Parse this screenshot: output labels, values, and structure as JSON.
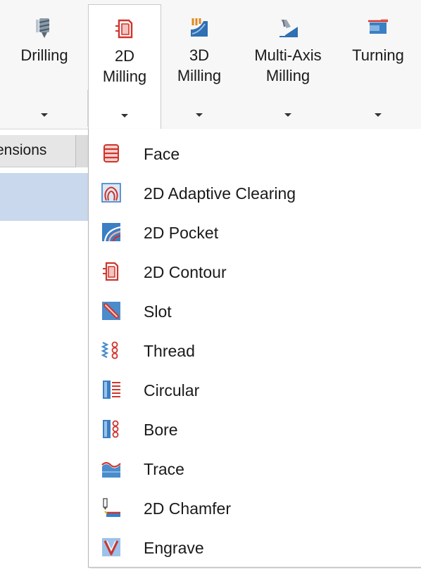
{
  "ribbon": {
    "buttons": [
      {
        "label": "Drilling",
        "icon": "drill-icon"
      },
      {
        "label": "2D\nMilling",
        "icon": "2d-milling-icon"
      },
      {
        "label": "3D\nMilling",
        "icon": "3d-milling-icon"
      },
      {
        "label": "Multi-Axis\nMilling",
        "icon": "multi-axis-milling-icon"
      },
      {
        "label": "Turning",
        "icon": "turning-icon"
      }
    ],
    "active": "2D Milling"
  },
  "panel": {
    "tab_label": "ensions"
  },
  "menu": {
    "items": [
      {
        "label": "Face",
        "icon": "face-icon"
      },
      {
        "label": "2D Adaptive Clearing",
        "icon": "adaptive-clearing-icon"
      },
      {
        "label": "2D Pocket",
        "icon": "pocket-icon"
      },
      {
        "label": "2D Contour",
        "icon": "contour-icon"
      },
      {
        "label": "Slot",
        "icon": "slot-icon"
      },
      {
        "label": "Thread",
        "icon": "thread-icon"
      },
      {
        "label": "Circular",
        "icon": "circular-icon"
      },
      {
        "label": "Bore",
        "icon": "bore-icon"
      },
      {
        "label": "Trace",
        "icon": "trace-icon"
      },
      {
        "label": "2D Chamfer",
        "icon": "chamfer-icon"
      },
      {
        "label": "Engrave",
        "icon": "engrave-icon"
      }
    ]
  },
  "colors": {
    "accent_red": "#d0342c",
    "accent_blue": "#3b7fc4",
    "panel_highlight": "#c9d8ec"
  }
}
